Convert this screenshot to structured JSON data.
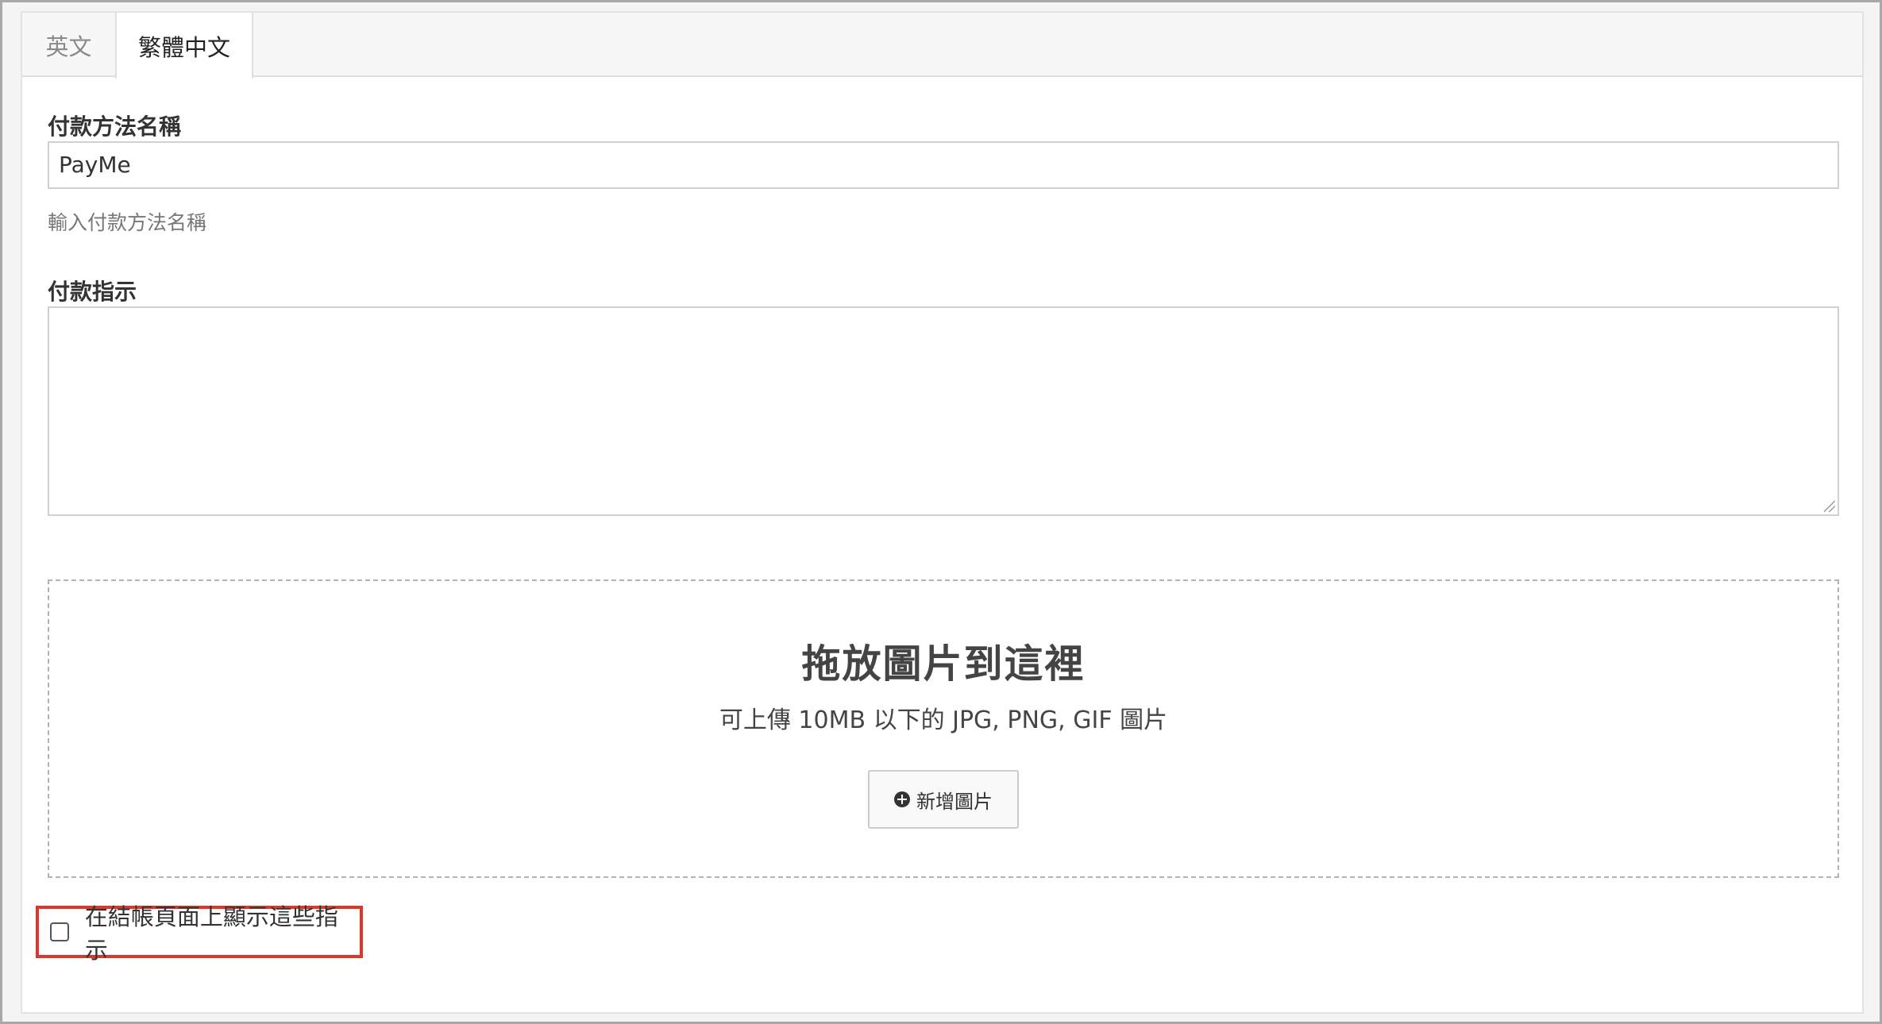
{
  "tabs": [
    {
      "label": "英文",
      "active": false
    },
    {
      "label": "繁體中文",
      "active": true
    }
  ],
  "name_field": {
    "label": "付款方法名稱",
    "value": "PayMe",
    "help": "輸入付款方法名稱"
  },
  "instructions_field": {
    "label": "付款指示",
    "value": ""
  },
  "dropzone": {
    "title": "拖放圖片到這裡",
    "subtitle": "可上傳 10MB 以下的 JPG, PNG, GIF 圖片",
    "button_label": "新增圖片",
    "button_icon": "plus-circle-icon"
  },
  "show_on_checkout": {
    "label": "在結帳頁面上顯示這些指示",
    "checked": false
  },
  "colors": {
    "highlight_border": "#e0352b"
  }
}
